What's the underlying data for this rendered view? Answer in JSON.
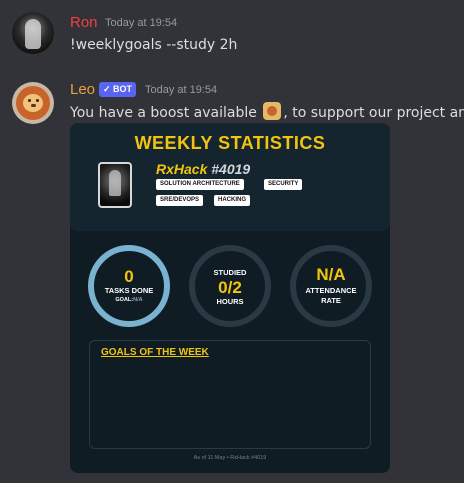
{
  "messages": [
    {
      "author": "Ron",
      "author_color": "#f23f43",
      "timestamp": "Today at 19:54",
      "text": "!weeklygoals --study 2h"
    },
    {
      "author": "Leo",
      "author_color": "#e9a23b",
      "badge": "✓ BOT",
      "timestamp": "Today at 19:54",
      "text_before": "You have a boost available",
      "text_after": ", to support our project and",
      "emoji": "lion-boost-emoji"
    }
  ],
  "card": {
    "title": "WEEKLY STATISTICS",
    "username": "RxHack",
    "discriminator": "#4019",
    "tags": [
      "SOLUTION ARCHITECTURE",
      "SECURITY",
      "SRE/DEVOPS",
      "HACKING"
    ],
    "stats": {
      "tasks": {
        "value": "0",
        "label": "TASKS DONE",
        "goal_label": "GOAL:",
        "goal_value": "N/A"
      },
      "studied": {
        "top_label": "STUDIED",
        "value": "0/2",
        "unit": "HOURS"
      },
      "attendance": {
        "value": "N/A",
        "label_line1": "ATTENDANCE",
        "label_line2": "RATE"
      }
    },
    "goals_title": "GOALS OF THE WEEK",
    "footer": "As of 11 May • RxHack #4019",
    "accent_color": "#f1c40f",
    "ring_active_color": "#7ab3cf"
  }
}
